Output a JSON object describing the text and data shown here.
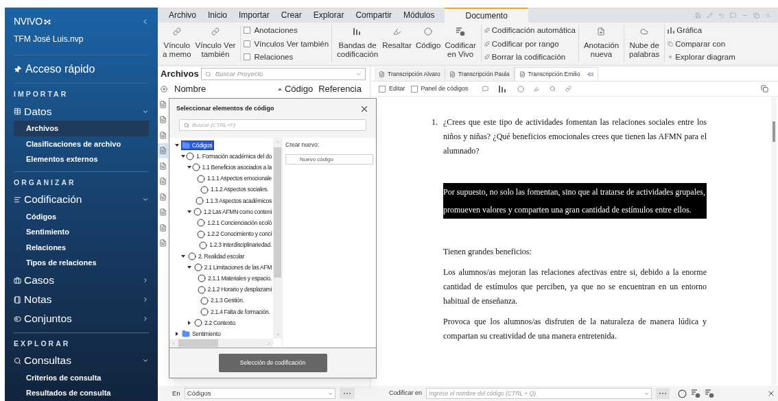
{
  "sidebar": {
    "logo": "NVIVO",
    "project": "TFM José Luis.nvp",
    "quick_access": "Acceso rápido",
    "sections": [
      {
        "title": "IMPORTAR",
        "groups": [
          {
            "label": "Datos",
            "kind": "data",
            "expanded": true,
            "items": [
              {
                "label": "Archivos",
                "selected": true
              },
              {
                "label": "Clasificaciones de archivo",
                "selected": false
              },
              {
                "label": "Elementos externos",
                "selected": false
              }
            ]
          }
        ]
      },
      {
        "title": "ORGANIZAR",
        "groups": [
          {
            "label": "Codificación",
            "kind": "coding",
            "expanded": true,
            "items": [
              {
                "label": "Códigos",
                "selected": false
              },
              {
                "label": "Sentimiento",
                "selected": false
              },
              {
                "label": "Relaciones",
                "selected": false
              },
              {
                "label": "Tipos de relaciones",
                "selected": false
              }
            ]
          },
          {
            "label": "Casos",
            "kind": "cases",
            "expanded": false
          },
          {
            "label": "Notas",
            "kind": "notes",
            "expanded": false
          },
          {
            "label": "Conjuntos",
            "kind": "sets",
            "expanded": false
          }
        ]
      },
      {
        "title": "EXPLORAR",
        "groups": [
          {
            "label": "Consultas",
            "kind": "queries",
            "expanded": true,
            "items": [
              {
                "label": "Criterios de consulta",
                "selected": false
              },
              {
                "label": "Resultados de consulta",
                "selected": false
              }
            ]
          }
        ]
      }
    ]
  },
  "ribbon": {
    "tabs": [
      {
        "label": "Archivo",
        "selected": false
      },
      {
        "label": "Inicio",
        "selected": false
      },
      {
        "label": "Importar",
        "selected": false
      },
      {
        "label": "Crear",
        "selected": false
      },
      {
        "label": "Explorar",
        "selected": false
      },
      {
        "label": "Compartir",
        "selected": false
      },
      {
        "label": "Módulos",
        "selected": false
      },
      {
        "label": "Documento",
        "selected": true
      }
    ],
    "groups": [
      {
        "kind": "big",
        "buttons": [
          "Vínculo\na memo",
          "Vínculo Ver\ntambién"
        ]
      },
      {
        "kind": "checks",
        "items": [
          {
            "label": "Anotaciones",
            "checked": false
          },
          {
            "label": "Vínculos Ver también",
            "checked": false
          },
          {
            "label": "Relaciones",
            "checked": false
          }
        ]
      },
      {
        "kind": "big",
        "buttons": [
          "Bandas de\ncodificación",
          "Resaltar",
          "Código",
          "Codificar\nen Vivo"
        ]
      },
      {
        "kind": "small",
        "items": [
          "Codificación automática",
          "Codificar por rango",
          "Borrar la codificación"
        ]
      },
      {
        "kind": "big",
        "buttons": [
          "Anotación\nnueva"
        ]
      },
      {
        "kind": "big",
        "buttons": [
          "Nube de\npalabras"
        ]
      },
      {
        "kind": "small",
        "items": [
          "Gráfica",
          "Comparar con",
          "Explorar diagram"
        ]
      }
    ]
  },
  "file_panel": {
    "title": "Archivos",
    "search_placeholder": "Buscar Proyecto",
    "columns": [
      {
        "label": "Nombre",
        "sorted": false
      },
      {
        "label": "Código",
        "sorted": true
      },
      {
        "label": "Referencia",
        "sorted": false
      }
    ],
    "rows": [
      {
        "selected": false
      },
      {
        "selected": false
      },
      {
        "selected": false
      },
      {
        "selected": true
      },
      {
        "selected": false
      },
      {
        "selected": false
      },
      {
        "selected": false
      },
      {
        "selected": false
      },
      {
        "selected": false
      },
      {
        "selected": false
      }
    ]
  },
  "code_dialog": {
    "title": "Seleccionar elementos de código",
    "search_placeholder": "Buscar (CTRL+F)",
    "create_label": "Crear nuevo:",
    "new_code": "Nuevo código",
    "confirm": "Selección de codificación",
    "tree": [
      {
        "label": "Códigos",
        "kind": "folder",
        "selected": true,
        "expanded": true,
        "children": [
          {
            "label": "1. Formación académica del do",
            "kind": "code",
            "selected": false,
            "expanded": true,
            "children": [
              {
                "label": "1.1 Beneficios asociados a la",
                "kind": "code",
                "selected": false,
                "expanded": true,
                "children": [
                  {
                    "label": "1.1.1 Aspectos emocionale",
                    "kind": "code",
                    "selected": false
                  },
                  {
                    "label": "1.1.2 Aspectos sociales.",
                    "kind": "code",
                    "selected": false
                  },
                  {
                    "label": "1.1.3 Aspectos académicos",
                    "kind": "code",
                    "selected": false
                  }
                ]
              },
              {
                "label": "1.2 Las AFMN como conteni",
                "kind": "code",
                "selected": false,
                "expanded": true,
                "children": [
                  {
                    "label": "1.2.1 Concienciación ecoló",
                    "kind": "code",
                    "selected": false
                  },
                  {
                    "label": "1.2.2 Conocimiento y conci",
                    "kind": "code",
                    "selected": false
                  },
                  {
                    "label": "1.2.3 Interdisciplinariedad.",
                    "kind": "code",
                    "selected": false
                  }
                ]
              }
            ]
          },
          {
            "label": "2. Realidad escolar",
            "kind": "code",
            "selected": false,
            "expanded": true,
            "children": [
              {
                "label": "2.1 Limitaciones de las AFM",
                "kind": "code",
                "selected": false,
                "expanded": true,
                "children": [
                  {
                    "label": "2.1.1 Materiales y espacio.",
                    "kind": "code",
                    "selected": false
                  },
                  {
                    "label": "2.1.2 Horario y desplazami",
                    "kind": "code",
                    "selected": false
                  },
                  {
                    "label": "2.1.3 Gestión.",
                    "kind": "code",
                    "selected": false
                  },
                  {
                    "label": "2.1.4 Falta de formación.",
                    "kind": "code",
                    "selected": false
                  }
                ]
              },
              {
                "label": "2.2 Contexto.",
                "kind": "code",
                "selected": false,
                "expanded": false
              }
            ]
          }
        ]
      },
      {
        "label": "Sentimiento",
        "kind": "folder",
        "selected": false,
        "expanded": false
      }
    ]
  },
  "document": {
    "tabs": [
      {
        "label": "Transcripción Alvaro",
        "selected": false
      },
      {
        "label": "Transcripción Paula",
        "selected": false
      },
      {
        "label": "Transcripción Emilio",
        "selected": true
      }
    ],
    "checkboxes": [
      {
        "label": "Editar",
        "checked": false
      },
      {
        "label": "Panel de códigos",
        "checked": false
      }
    ],
    "question": {
      "number": "1.",
      "text": "¿Crees que este tipo de actividades fomentan las relaciones sociales entre los niños y niñas? ¿Qué beneficios emocionales crees que tienen las AFMN para el alumnado?"
    },
    "paragraphs": [
      {
        "text": "Por supuesto, no solo las fomentan, sino que al tratarse de actividades grupales, promueven valores y comparten una gran cantidad de estímulos entre ellos.",
        "highlighted": true
      },
      {
        "text": "Tienen grandes beneficios:",
        "highlighted": false
      },
      {
        "text": "Los alumnos/as mejoran las relaciones afectivas entre si, debido a la enorme cantidad de estímulos que perciben, ya que no se encuentran en un entorno habitual de enseñanza.",
        "highlighted": false
      },
      {
        "text": "Provoca que los alumnos/as  disfruten de la naturaleza de manera lúdica y compartan su creatividad de una manera entretenida.",
        "highlighted": false
      }
    ]
  },
  "bottom_bar": {
    "scope_label": "En",
    "scope_value": "Códigos",
    "code_label": "Codificar en",
    "code_placeholder": "Ingrese el nombre del código (CTRL + Q)"
  }
}
